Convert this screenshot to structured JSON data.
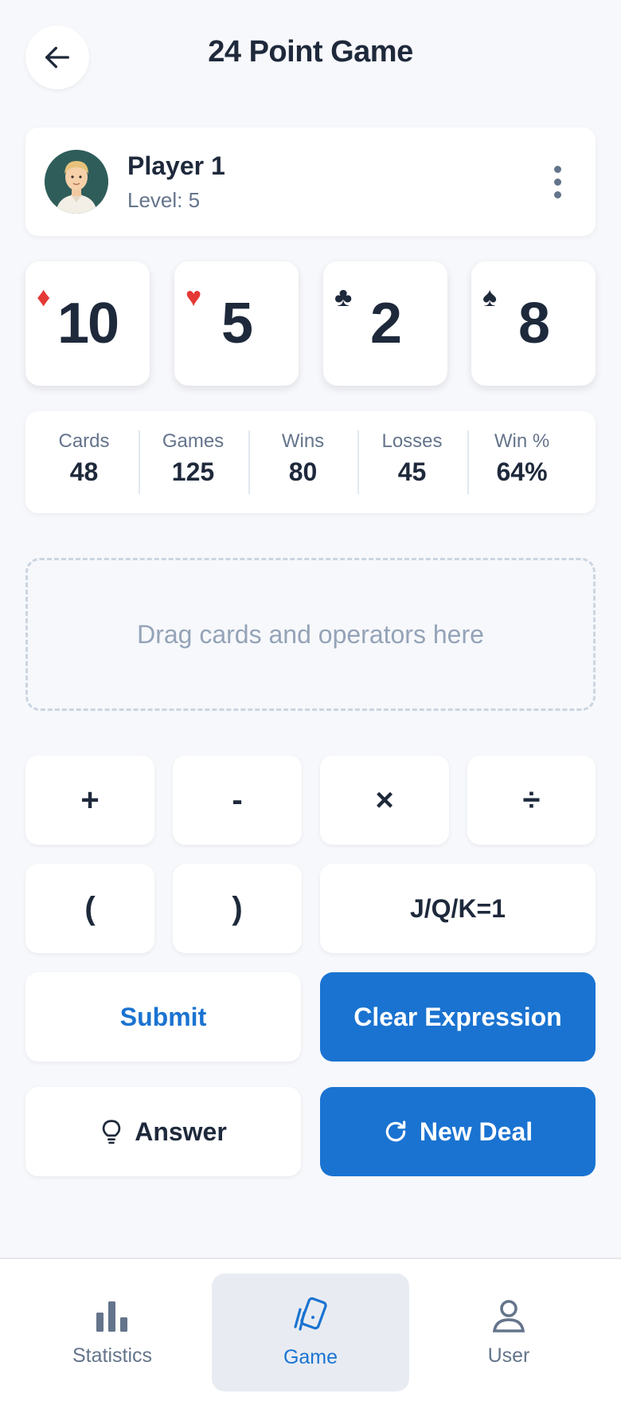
{
  "header": {
    "title": "24 Point Game"
  },
  "player": {
    "name": "Player 1",
    "level": "Level: 5"
  },
  "cards": [
    {
      "suit": "♦",
      "rank": "10",
      "color": "#e53935"
    },
    {
      "suit": "♥",
      "rank": "5",
      "color": "#e53935"
    },
    {
      "suit": "♣",
      "rank": "2",
      "color": "#1e293b"
    },
    {
      "suit": "♠",
      "rank": "8",
      "color": "#1e293b"
    }
  ],
  "stats": [
    {
      "label": "Cards",
      "value": "48"
    },
    {
      "label": "Games",
      "value": "125"
    },
    {
      "label": "Wins",
      "value": "80"
    },
    {
      "label": "Losses",
      "value": "45"
    },
    {
      "label": "Win %",
      "value": "64%"
    }
  ],
  "dropzone": {
    "placeholder": "Drag cards and operators here"
  },
  "operators": {
    "plus": "+",
    "minus": "-",
    "times": "×",
    "divide": "÷",
    "open_paren": "(",
    "close_paren": ")",
    "face_rule": "J/Q/K=1"
  },
  "actions": {
    "submit": "Submit",
    "clear": "Clear Expression",
    "answer": "Answer",
    "new_deal": "New Deal"
  },
  "nav": {
    "statistics": "Statistics",
    "game": "Game",
    "user": "User"
  },
  "colors": {
    "accent": "#1a73d1",
    "text": "#1e293b",
    "muted": "#64748b",
    "red_suit": "#e53935"
  }
}
